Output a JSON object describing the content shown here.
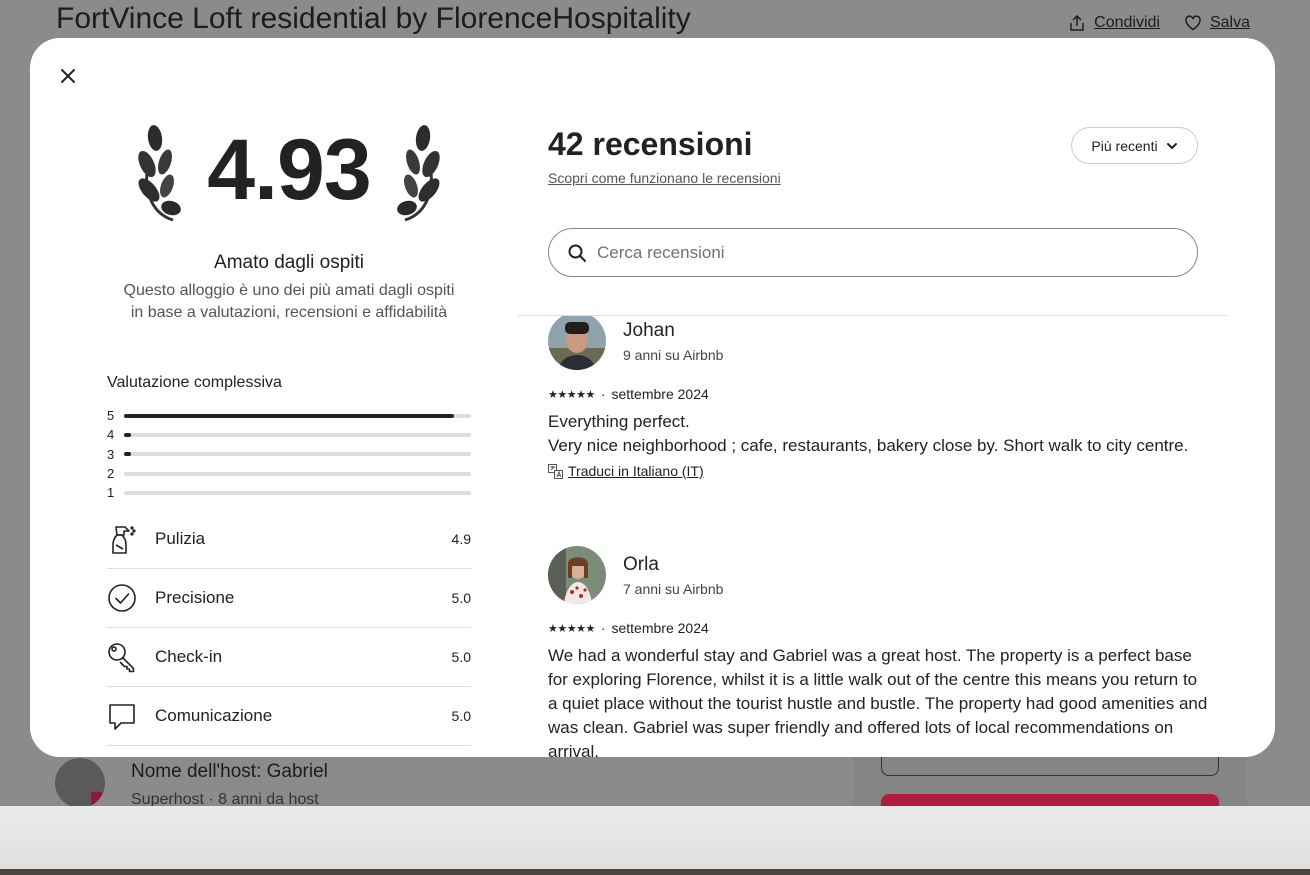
{
  "background": {
    "title": "FortVince Loft residential by FlorenceHospitality",
    "share_label": "Condividi",
    "save_label": "Salva",
    "host_name": "Nome dell'host: Gabriel",
    "host_sub": "Superhost · 8 anni da host"
  },
  "summary": {
    "rating": "4.93",
    "badge_title": "Amato dagli ospiti",
    "badge_desc": "Questo alloggio è uno dei più amati dagli ospiti in base a valutazioni, recensioni e affidabilità",
    "overall_label": "Valutazione complessiva",
    "distribution": [
      {
        "stars": "5",
        "fraction": 0.95
      },
      {
        "stars": "4",
        "fraction": 0.02
      },
      {
        "stars": "3",
        "fraction": 0.02
      },
      {
        "stars": "2",
        "fraction": 0
      },
      {
        "stars": "1",
        "fraction": 0
      }
    ],
    "categories": [
      {
        "label": "Pulizia",
        "value": "4.9",
        "icon": "spray-bottle-icon"
      },
      {
        "label": "Precisione",
        "value": "5.0",
        "icon": "check-circle-icon"
      },
      {
        "label": "Check-in",
        "value": "5.0",
        "icon": "key-icon"
      },
      {
        "label": "Comunicazione",
        "value": "5.0",
        "icon": "chat-bubble-icon"
      }
    ]
  },
  "reviews_header": {
    "count_label": "42 recensioni",
    "how_link": "Scopri come funzionano le recensioni",
    "sort_label": "Più recenti",
    "search_placeholder": "Cerca recensioni"
  },
  "reviews": [
    {
      "name": "Johan",
      "since": "9 anni su Airbnb",
      "stars": "★★★★★",
      "date": "settembre 2024",
      "text": "Everything perfect.\nVery nice neighborhood ; cafe, restaurants, bakery close by. Short walk to city centre.",
      "translate": "Traduci in Italiano (IT)"
    },
    {
      "name": "Orla",
      "since": "7 anni su Airbnb",
      "stars": "★★★★★",
      "date": "settembre 2024",
      "text": "We had a wonderful stay and Gabriel was a great host. The property is a perfect base for exploring Florence, whilst it is a little walk out of the centre this means you return to a quiet place without the tourist hustle and bustle. The property had good amenities and was clean. Gabriel was super friendly and offered lots of local recommendations on arrival."
    }
  ],
  "colors": {
    "text": "#222222",
    "muted": "#717171",
    "divider": "#dddddd",
    "brand": "#b01b43"
  }
}
